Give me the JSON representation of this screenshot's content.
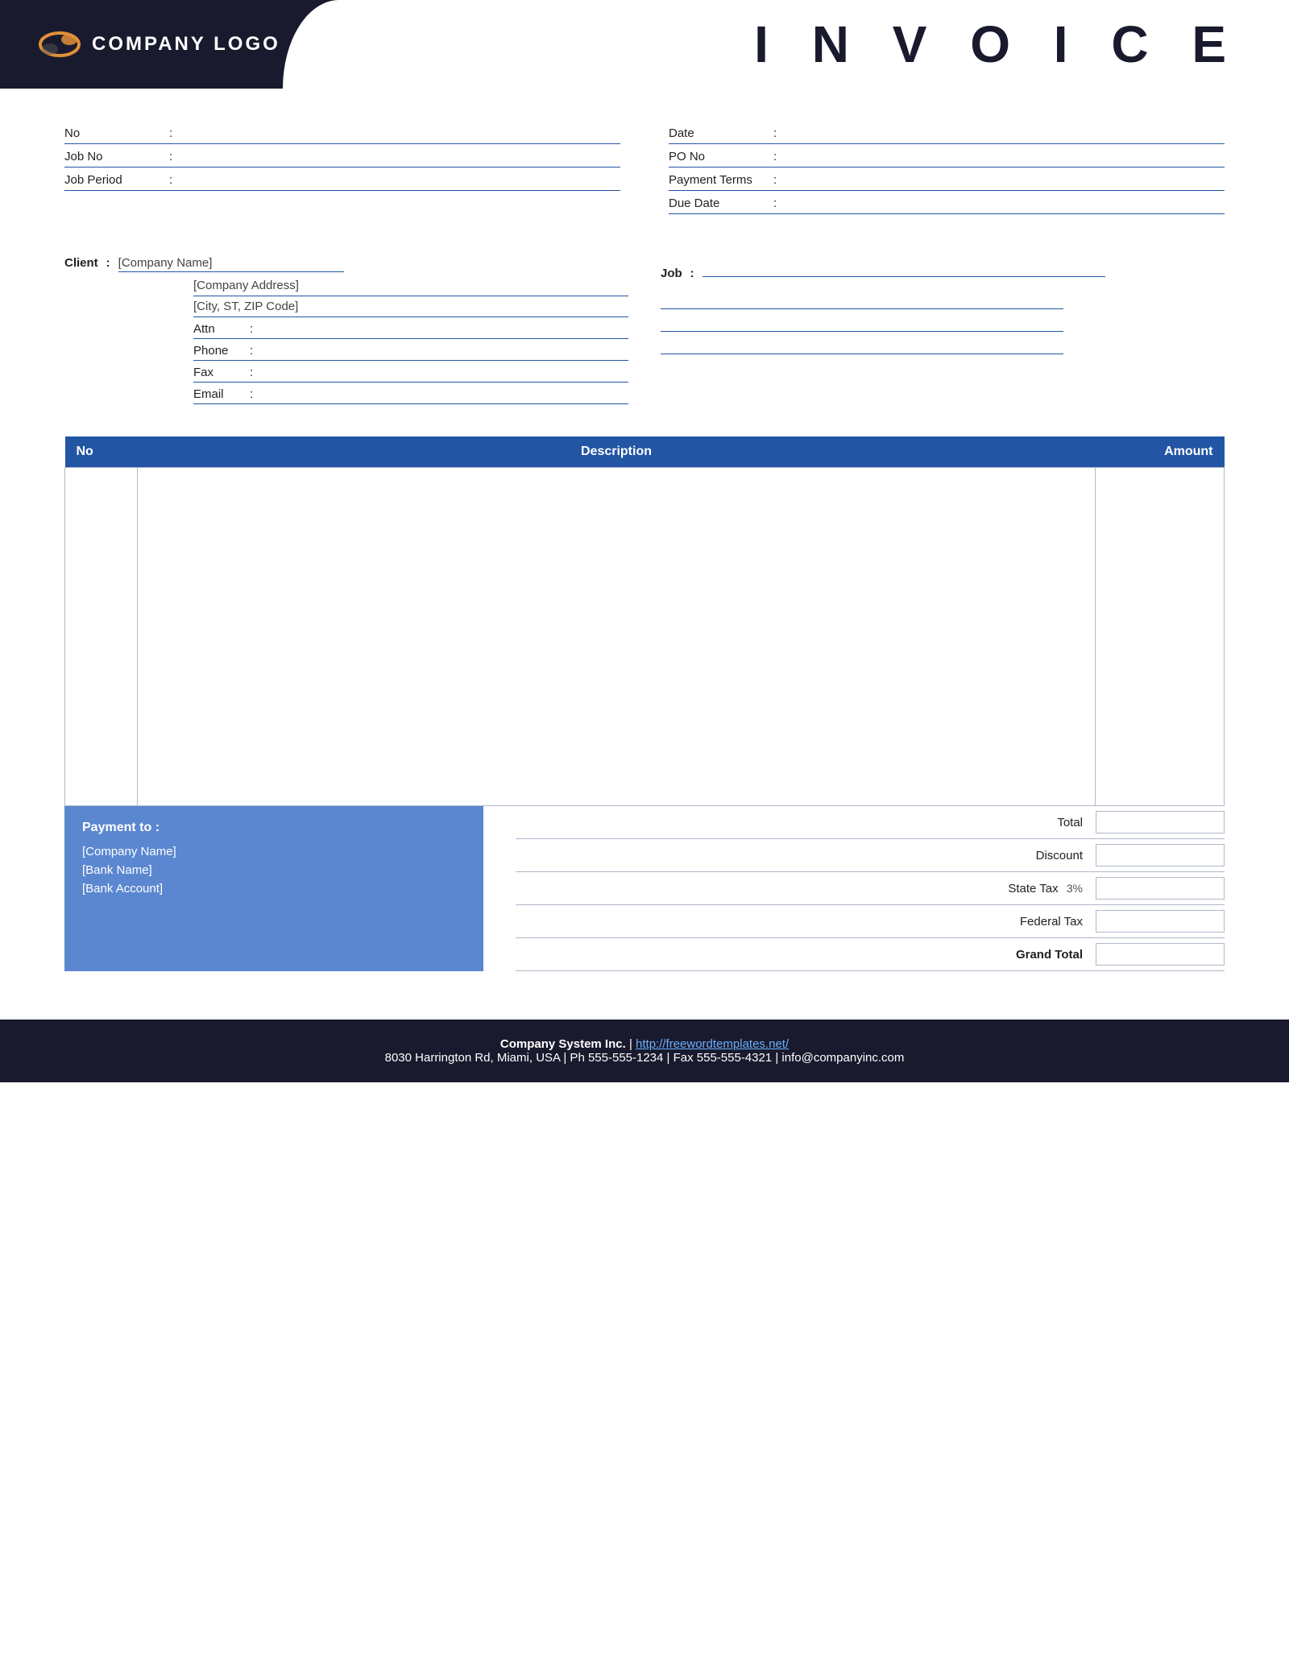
{
  "header": {
    "logo_text": "COMPANY LOGO",
    "invoice_title": "I N V O I C E"
  },
  "form": {
    "left": [
      {
        "label": "No",
        "colon": ":",
        "value": ""
      },
      {
        "label": "Job No",
        "colon": ":",
        "value": ""
      },
      {
        "label": "Job Period",
        "colon": ":",
        "value": ""
      }
    ],
    "right": [
      {
        "label": "Date",
        "colon": ":",
        "value": ""
      },
      {
        "label": "PO No",
        "colon": ":",
        "value": ""
      },
      {
        "label": "Payment  Terms",
        "colon": ":",
        "value": ""
      },
      {
        "label": "Due Date",
        "colon": ":",
        "value": ""
      }
    ]
  },
  "client": {
    "label": "Client",
    "colon": ":",
    "company_name": "[Company Name]",
    "company_address": "[Company Address]",
    "city_state_zip": "[City, ST, ZIP Code]",
    "attn_label": "Attn",
    "phone_label": "Phone",
    "fax_label": "Fax",
    "email_label": "Email"
  },
  "job": {
    "label": "Job",
    "colon": ":",
    "lines": [
      "",
      "",
      "",
      ""
    ]
  },
  "table": {
    "headers": {
      "no": "No",
      "description": "Description",
      "amount": "Amount"
    }
  },
  "payment": {
    "title": "Payment to :",
    "company_name": "[Company Name]",
    "bank_name": "[Bank Name]",
    "bank_account": "[Bank Account]"
  },
  "totals": [
    {
      "label": "Total",
      "value": "",
      "bold": false,
      "pct": ""
    },
    {
      "label": "Discount",
      "value": "",
      "bold": false,
      "pct": ""
    },
    {
      "label": "State Tax",
      "value": "",
      "bold": false,
      "pct": "3%"
    },
    {
      "label": "Federal Tax",
      "value": "",
      "bold": false,
      "pct": ""
    },
    {
      "label": "Grand Total",
      "value": "",
      "bold": true,
      "pct": ""
    }
  ],
  "footer": {
    "company": "Company System Inc.",
    "separator": "|",
    "website": "http://freewordtemplates.net/",
    "address": "8030 Harrington Rd, Miami, USA | Ph 555-555-1234 | Fax 555-555-4321 | info@companyinc.com"
  }
}
